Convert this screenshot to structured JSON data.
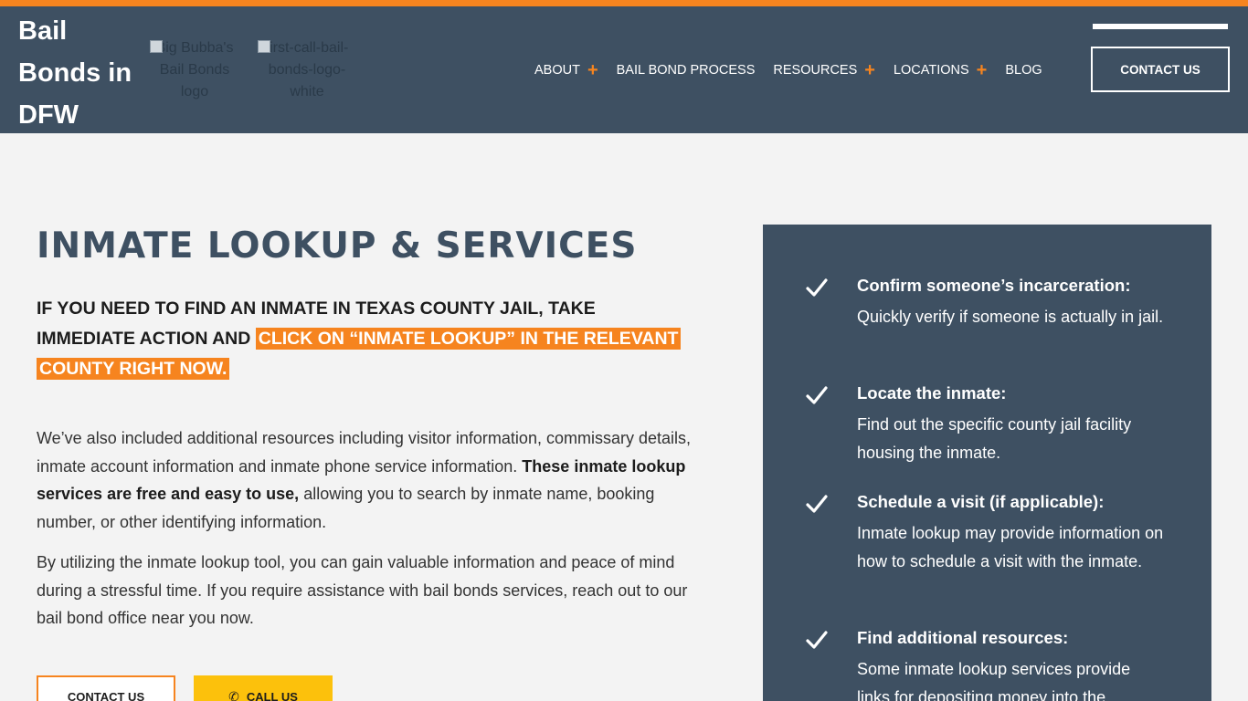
{
  "colors": {
    "accent": "#f6841f",
    "navy": "#3e5062",
    "yellow": "#fcc10c",
    "background": "#f3f3f3"
  },
  "header": {
    "site_title": "Bail Bonds in DFW",
    "logo1_alt": "Big Bubba's Bail Bonds logo",
    "logo2_alt": "first-call-bail-bonds-logo-white",
    "nav": [
      {
        "label": "ABOUT",
        "has_submenu": true
      },
      {
        "label": "BAIL BOND PROCESS",
        "has_submenu": false
      },
      {
        "label": "RESOURCES",
        "has_submenu": true
      },
      {
        "label": "LOCATIONS",
        "has_submenu": true
      },
      {
        "label": "BLOG",
        "has_submenu": false
      }
    ],
    "plus_symbol": "+",
    "contact_label": "CONTACT US"
  },
  "main": {
    "title": "INMATE LOOKUP & SERVICES",
    "lead_plain": "IF YOU NEED TO FIND AN INMATE IN TEXAS COUNTY JAIL, TAKE IMMEDIATE ACTION AND ",
    "lead_highlight": "CLICK ON “INMATE LOOKUP” IN THE RELEVANT COUNTY RIGHT NOW.",
    "para1_a": "We’ve also included additional resources including visitor information, commissary details, inmate account information and inmate phone service information. ",
    "para1_bold": "These inmate lookup services are free and easy to use,",
    "para1_b": " allowing you to search by inmate name, booking number, or other identifying information.",
    "para2": "By utilizing the inmate lookup tool, you can gain valuable information and peace of mind during a stressful time. If you require assistance with bail bonds services, reach out to our bail bond office near you now.",
    "contact_button": "CONTACT US",
    "call_button": "CALL US",
    "phone_icon": "phone-icon"
  },
  "panel": {
    "icon": "check-icon",
    "features": [
      {
        "title": "Confirm someone’s incarceration:",
        "desc": "Quickly verify if someone is actually in jail."
      },
      {
        "title": "Locate the inmate:",
        "desc": "Find out the specific county jail facility housing the inmate."
      },
      {
        "title": "Schedule a visit (if applicable):",
        "desc": "Inmate lookup may provide information on how to schedule a visit with the inmate."
      },
      {
        "title": "Find additional resources:",
        "desc": "Some inmate lookup services provide links for depositing money into the"
      }
    ]
  }
}
